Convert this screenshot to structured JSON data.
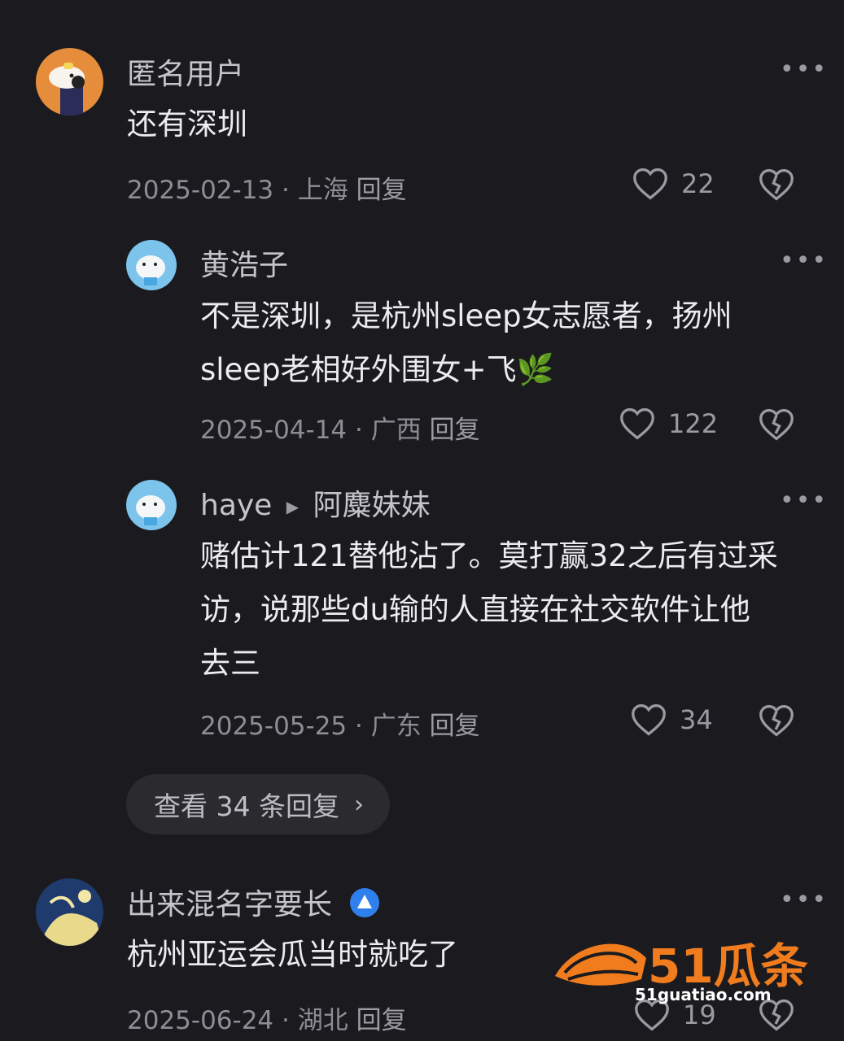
{
  "comments": [
    {
      "user": "匿名用户",
      "text": "还有深圳",
      "date": "2025-02-13",
      "location": "上海",
      "reply_label": "回复",
      "likes": "22"
    },
    {
      "user": "黄浩子",
      "text_line1": "不是深圳，是杭州sleep女志愿者，扬州",
      "text_line2": "sleep老相好外围女+飞🌿",
      "date": "2025-04-14",
      "location": "广西",
      "reply_label": "回复",
      "likes": "122"
    },
    {
      "user": "haye",
      "reply_to": "阿麋妹妹",
      "text_line1": "赌估计121替他沾了。莫打赢32之后有过采",
      "text_line2": "访，说那些du输的人直接在社交软件让他",
      "text_line3": "去三",
      "date": "2025-05-25",
      "location": "广东",
      "reply_label": "回复",
      "likes": "34"
    },
    {
      "user": "出来混名字要长",
      "text": "杭州亚运会瓜当时就吃了",
      "date": "2025-06-24",
      "location": "湖北",
      "reply_label": "回复",
      "likes": "19"
    }
  ],
  "view_replies": "查看 34 条回复",
  "separator": "·",
  "more_label": "•••",
  "watermark": {
    "brand": "51瓜条",
    "url": "51guatiao.com"
  },
  "colors": {
    "background": "#1b1b1f",
    "accent_badge": "#2f80ed",
    "watermark_orange": "#f07c1e"
  }
}
